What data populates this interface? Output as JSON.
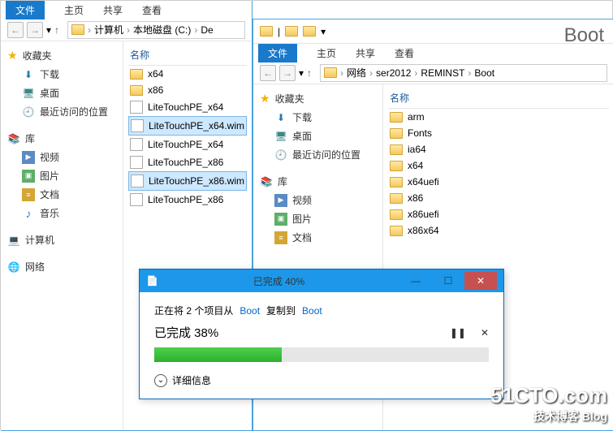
{
  "menu": {
    "file": "文件",
    "home": "主页",
    "share": "共享",
    "view": "查看"
  },
  "win1": {
    "breadcrumb": [
      "计算机",
      "本地磁盘 (C:)",
      "De"
    ],
    "nameCol": "名称",
    "tree": {
      "fav": "收藏夹",
      "dl": "下载",
      "desk": "桌面",
      "recent": "最近访问的位置",
      "lib": "库",
      "vid": "视频",
      "pic": "图片",
      "doc": "文档",
      "mus": "音乐",
      "pc": "计算机",
      "net": "网络"
    },
    "files": [
      "x64",
      "x86",
      "LiteTouchPE_x64",
      "LiteTouchPE_x64.wim",
      "LiteTouchPE_x64",
      "LiteTouchPE_x86",
      "LiteTouchPE_x86.wim",
      "LiteTouchPE_x86"
    ]
  },
  "win2": {
    "title": "Boot",
    "breadcrumb": [
      "网络",
      "ser2012",
      "REMINST",
      "Boot"
    ],
    "nameCol": "名称",
    "files": [
      "arm",
      "Fonts",
      "ia64",
      "x64",
      "x64uefi",
      "x86",
      "x86uefi",
      "x86x64"
    ]
  },
  "dialog": {
    "title": "已完成 40%",
    "copying_prefix": "正在将 2 个项目从 ",
    "src": "Boot",
    "mid": " 复制到 ",
    "dst": "Boot",
    "progress_label": "已完成 38%",
    "progress_pct": 38,
    "details": "详细信息"
  },
  "watermark": {
    "big": "51CTO.com",
    "small": "技术博客  Blog"
  }
}
